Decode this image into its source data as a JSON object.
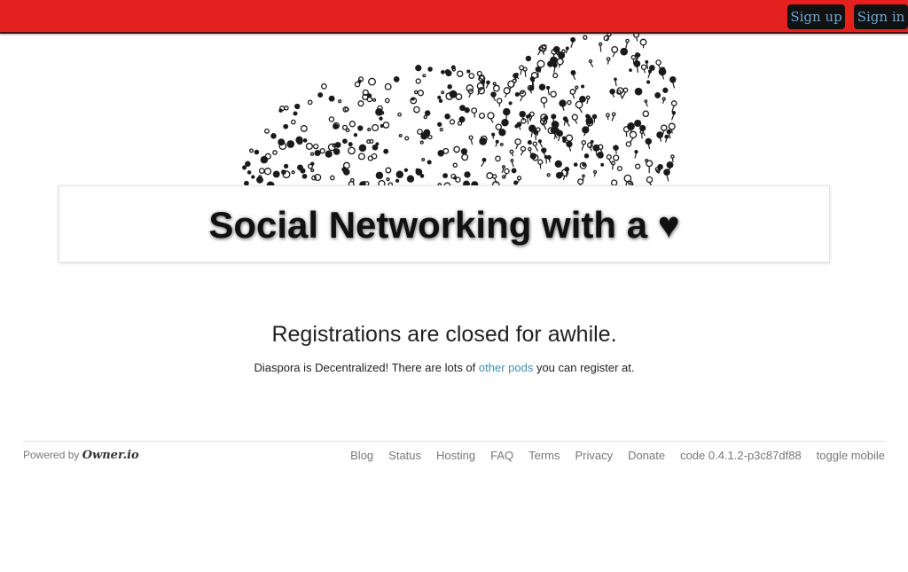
{
  "header": {
    "signup_label": "Sign up",
    "signin_label": "Sign in",
    "bar_color": "#e3211e"
  },
  "hero": {
    "title": "Social Networking with a ♥"
  },
  "registration": {
    "heading": "Registrations are closed for awhile.",
    "text_before": "Diaspora is Decentralized! There are lots of ",
    "link_label": "other pods",
    "text_after": " you can register at."
  },
  "footer": {
    "powered_prefix": "Powered by ",
    "powered_brand": "Owner.io",
    "links": [
      "Blog",
      "Status",
      "Hosting",
      "FAQ",
      "Terms",
      "Privacy",
      "Donate"
    ],
    "code_version": "code 0.4.1.2-p3c87df88",
    "toggle_label": "toggle mobile"
  }
}
